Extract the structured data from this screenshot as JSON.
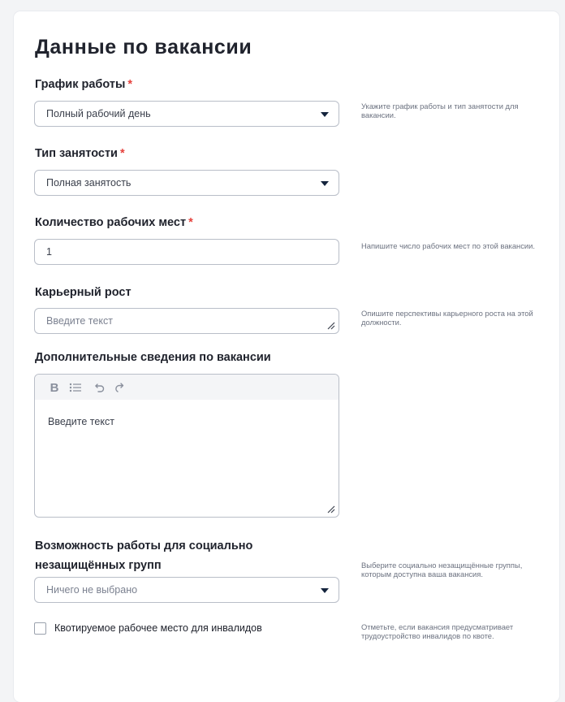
{
  "form": {
    "title": "Данные по вакансии",
    "required_mark": "*",
    "schedule": {
      "label": "График работы",
      "value": "Полный рабочий день",
      "hint": "Укажите график работы и тип занятости для вакансии."
    },
    "employment_type": {
      "label": "Тип занятости",
      "value": "Полная занятость"
    },
    "workplaces": {
      "label": "Количество рабочих мест",
      "value": "1",
      "hint": "Напишите число рабочих мест по этой вакансии."
    },
    "career": {
      "label": "Карьерный рост",
      "placeholder": "Введите текст",
      "hint": "Опишите перспективы карьерного роста на этой должности."
    },
    "additional": {
      "label": "Дополнительные сведения по вакансии",
      "placeholder": "Введите текст",
      "toolbar": {
        "bold": "B"
      }
    },
    "social_groups": {
      "label_line1": "Возможность работы для социально",
      "label_line2": "незащищённых групп",
      "placeholder": "Ничего не выбрано",
      "hint": "Выберите социально незащищённые группы, которым доступна ваша вакансия."
    },
    "quota": {
      "label": "Квотируемое рабочее место для инвалидов",
      "hint": "Отметьте, если вакансия предусматривает трудоустройство инвалидов по квоте."
    }
  },
  "icons": {
    "dropdown": "chevron-down-icon",
    "bold": "bold-icon",
    "list": "bullet-list-icon",
    "undo": "undo-icon",
    "redo": "redo-icon",
    "resize": "resize-handle-icon"
  },
  "colors": {
    "required": "#e5413c",
    "caret": "#14243d",
    "border": "#b9bec8"
  }
}
